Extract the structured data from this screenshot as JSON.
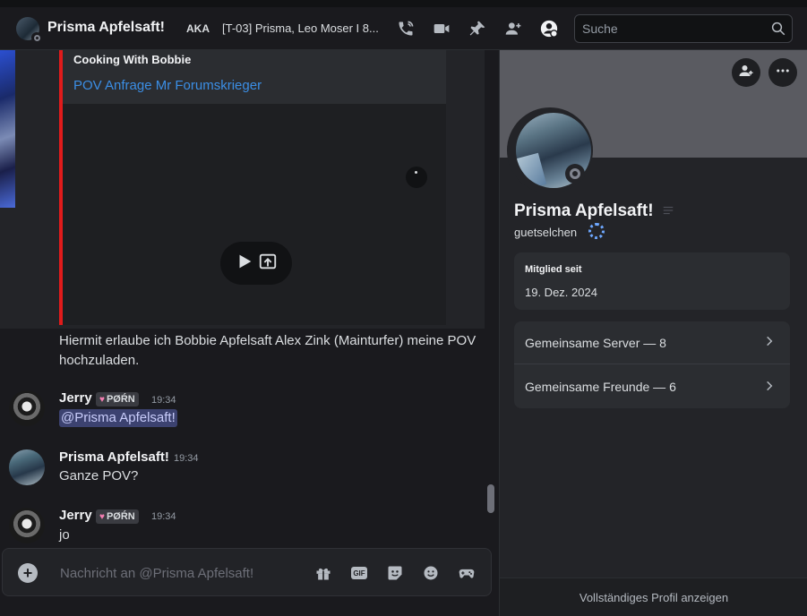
{
  "topbar": {
    "title": "Prisma Apfelsaft!",
    "aka_label": "AKA",
    "server_tag": "[T-03] Prisma, Leo Moser I 8...",
    "icons": [
      "phone-icon",
      "video-icon",
      "pin-icon",
      "add-friend-icon",
      "profile-toggle-icon"
    ],
    "search_placeholder": "Suche"
  },
  "embed": {
    "author": "Cooking With Bobbie",
    "title_link": "POV Anfrage Mr Forumskrieger",
    "accent_color": "#e01b1b"
  },
  "messages": [
    {
      "text": "Hiermit erlaube ich Bobbie Apfelsaft Alex Zink (Mainturfer) meine POV hochzuladen."
    },
    {
      "author": "Jerry",
      "badge": "PØŔN",
      "time": "19:34",
      "mention": "@Prisma Apfelsaft!"
    },
    {
      "author": "Prisma Apfelsaft!",
      "time": "19:34",
      "text": "Ganze POV?"
    },
    {
      "author": "Jerry",
      "badge": "PØŔN",
      "time": "19:34",
      "text": "jo"
    }
  ],
  "composer": {
    "placeholder": "Nachricht an @Prisma Apfelsaft!",
    "gif_label": "GIF"
  },
  "profile": {
    "display_name": "Prisma Apfelsaft!",
    "username": "guetselchen",
    "member_since_label": "Mitglied seit",
    "member_since_value": "19. Dez. 2024",
    "mutual_servers": "Gemeinsame Server — 8",
    "mutual_friends": "Gemeinsame Freunde — 6",
    "full_profile": "Vollständiges Profil anzeigen"
  }
}
